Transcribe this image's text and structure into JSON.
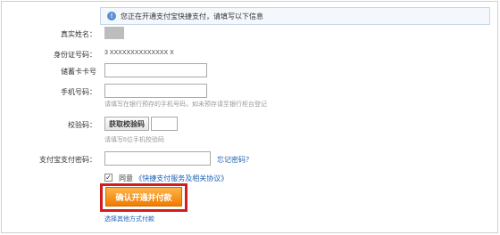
{
  "notice": {
    "icon": "info-icon",
    "text": "您正在开通支付宝快捷支付，请填写以下信息"
  },
  "form": {
    "name_label": "真实姓名：",
    "id_label": "身份证号码：",
    "id_value": "3 XXXXXXXXXXXXXX X",
    "card_label": "储蓄卡卡号",
    "phone_label": "手机号码：",
    "phone_hint": "请填写在银行预存的手机号码，如未预存请至银行柜台登记",
    "code_label": "校验码：",
    "code_button": "获取校验码",
    "code_hint": "请填写6位手机校验码",
    "password_label": "支付宝支付密码：",
    "forgot_link": "忘记密码？",
    "agree_check": "✓",
    "agree_text": "同意",
    "agree_link": "《快捷支付服务及相关协议》",
    "confirm_button": "确认开通并付款",
    "other_link": "选择其他方式付款"
  },
  "colors": {
    "accent_orange": "#f07c00",
    "highlight_red": "#d21d1d",
    "link_blue": "#1a5fb4"
  }
}
